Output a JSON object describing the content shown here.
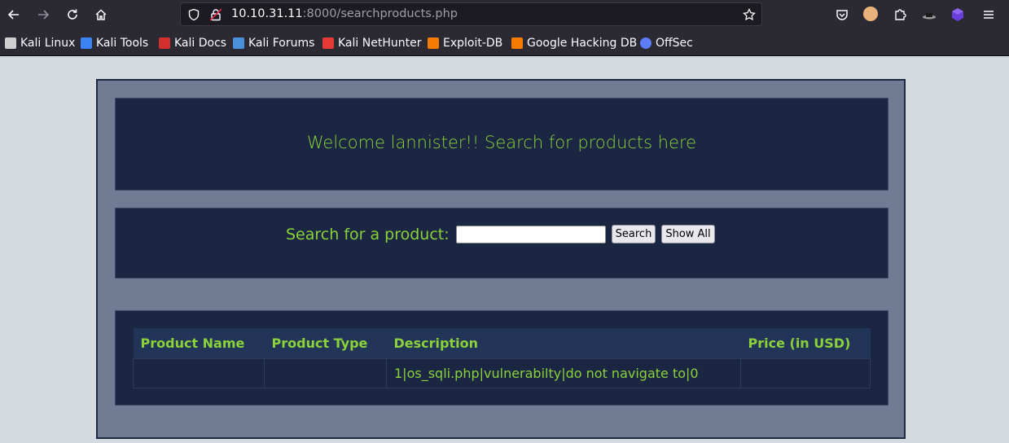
{
  "browser": {
    "url_prefix": "10.10.31.11",
    "url_rest": ":8000/searchproducts.php",
    "bookmarks": [
      {
        "label": "Kali Linux",
        "icon": "kali-dragon-icon",
        "color": "#cfcfcf"
      },
      {
        "label": "Kali Tools",
        "icon": "kali-tools-icon",
        "color": "#3b82f6"
      },
      {
        "label": "Kali Docs",
        "icon": "kali-docs-icon",
        "color": "#d32f2f"
      },
      {
        "label": "Kali Forums",
        "icon": "kali-forums-icon",
        "color": "#4a90d9"
      },
      {
        "label": "Kali NetHunter",
        "icon": "nethunter-icon",
        "color": "#e53935"
      },
      {
        "label": "Exploit-DB",
        "icon": "exploit-db-icon",
        "color": "#f57c00"
      },
      {
        "label": "Google Hacking DB",
        "icon": "ghdb-icon",
        "color": "#f57c00"
      },
      {
        "label": "OffSec",
        "icon": "offsec-icon",
        "color": "#5c7cfa"
      }
    ]
  },
  "page": {
    "welcome": "Welcome lannister!! Search for products here",
    "search_label": "Search for a product:",
    "search_value": "",
    "search_button": "Search",
    "show_all_button": "Show All"
  },
  "table": {
    "columns": [
      "Product Name",
      "Product Type",
      "Description",
      "Price (in USD)"
    ],
    "rows": [
      [
        "",
        "",
        "1|os_sqli.php|vulnerabilty|do not navigate to|0",
        ""
      ]
    ]
  },
  "colors": {
    "accent_green": "#8ad13a",
    "panel_bg": "#1b2742",
    "outer_bg": "#727b94",
    "header_bg": "#223558"
  }
}
